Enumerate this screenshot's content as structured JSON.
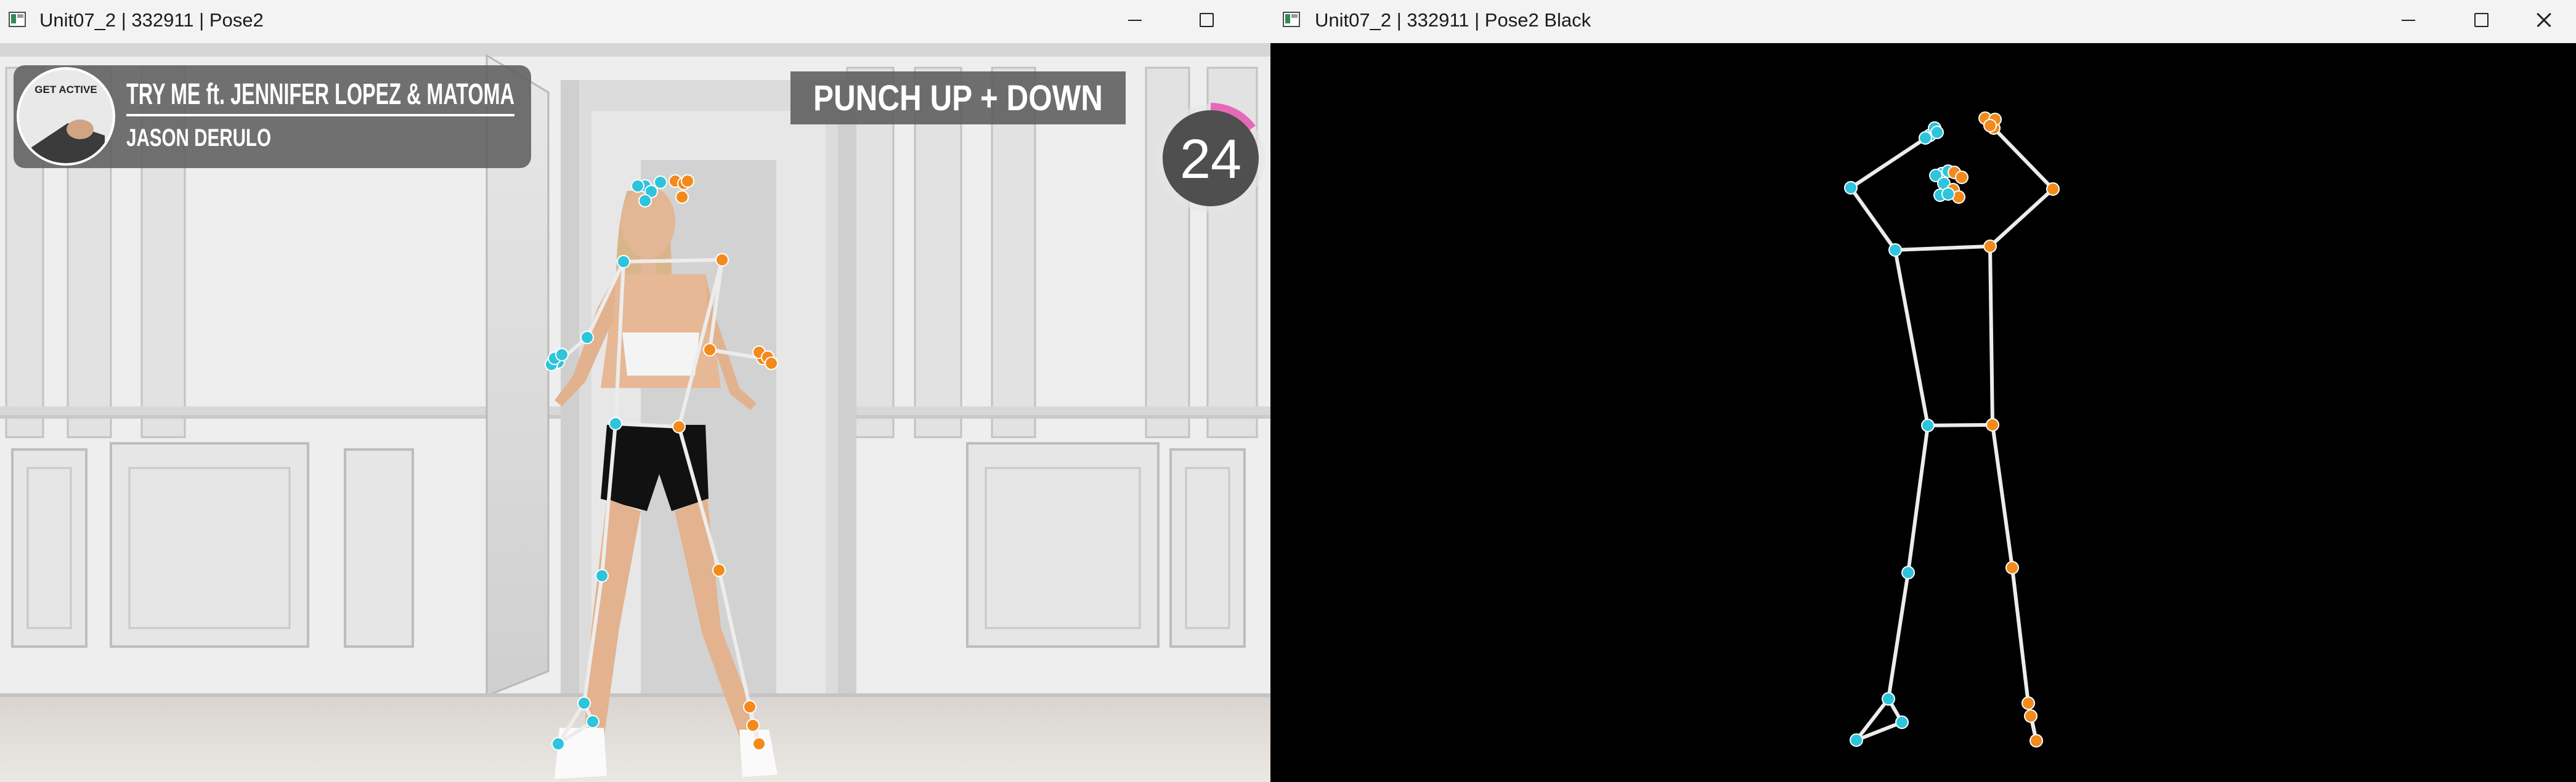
{
  "left_window": {
    "title": "Unit07_2 | 332911 | Pose2",
    "video": {
      "badge_label": "GET ACTIVE",
      "song_title": "TRY ME ft. JENNIFER LOPEZ & MATOMA",
      "artist": "JASON DERULO",
      "move_label": "PUNCH UP + DOWN",
      "countdown": "24",
      "countdown_progress": 0.15
    }
  },
  "right_window": {
    "title": "Unit07_2 | 332911 | Pose2 Black"
  },
  "colors": {
    "left_keypoint": "#2ec4dc",
    "right_keypoint": "#f28a1c",
    "skeleton_line": "#ececec",
    "overlay_bg": "#5f5f5f"
  }
}
